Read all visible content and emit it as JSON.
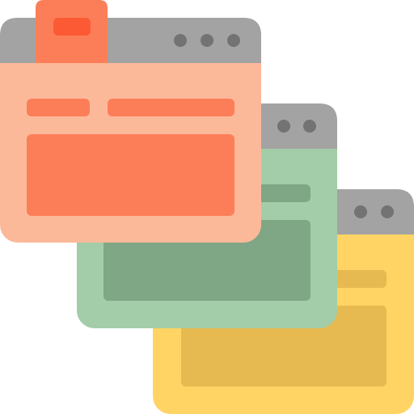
{
  "illustration": {
    "subject": "stacked-browser-windows",
    "colors": {
      "titlebar": "#A3A3A3",
      "titlebar_dot": "#737373"
    },
    "windows": [
      {
        "name": "back-window",
        "tab_count": 0,
        "titlebar_dots": 2,
        "colors": {
          "body": "#FFD464",
          "content": "#E6BA50"
        }
      },
      {
        "name": "middle-window",
        "tab_count": 0,
        "titlebar_dots": 2,
        "colors": {
          "body": "#A3CDA8",
          "content": "#7FA685"
        }
      },
      {
        "name": "front-window",
        "tab_count": 1,
        "titlebar_dots": 3,
        "colors": {
          "body": "#FCB99A",
          "content": "#FC7E59",
          "tab": "#FC7E59",
          "tab_indicator": "#FC5A34"
        }
      }
    ]
  }
}
